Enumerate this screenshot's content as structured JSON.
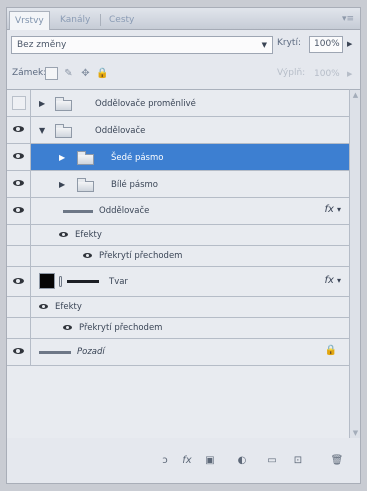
{
  "tabs": [
    {
      "label": "Vrstvy"
    },
    {
      "label": "Kanály"
    },
    {
      "label": "Cesty"
    }
  ],
  "panel_menu_icon": "panel-menu-icon",
  "blend_mode": {
    "value": "Bez změny"
  },
  "opacity": {
    "label": "Krytí:",
    "value": "100%"
  },
  "lock": {
    "label": "Zámek:",
    "icons": [
      "lock-transparent-icon",
      "lock-image-icon",
      "lock-position-icon",
      "lock-all-icon"
    ]
  },
  "fill": {
    "label": "Výplň:",
    "value": "100%"
  },
  "layers": [
    {
      "name": "Oddělovače proměnlivé",
      "type": "group",
      "expanded": false,
      "visible": false
    },
    {
      "name": "Oddělovače",
      "type": "group",
      "expanded": true,
      "visible": true
    },
    {
      "name": "Šedé pásmo",
      "type": "group",
      "expanded": false,
      "visible": true,
      "selected": true
    },
    {
      "name": "Bílé pásmo",
      "type": "group",
      "expanded": false,
      "visible": true
    },
    {
      "name": "Oddělovače",
      "type": "shape",
      "visible": true,
      "fx": "fx"
    },
    {
      "name": "Efekty",
      "type": "effects-header",
      "visible": true
    },
    {
      "name": "Překrytí přechodem",
      "type": "effect",
      "visible": true
    },
    {
      "name": "Tvar",
      "type": "shape",
      "visible": true,
      "fx": "fx"
    },
    {
      "name": "Efekty",
      "type": "effects-header",
      "visible": true
    },
    {
      "name": "Překrytí přechodem",
      "type": "effect",
      "visible": true
    },
    {
      "name": "Pozadí",
      "type": "background",
      "visible": true,
      "locked": true
    }
  ],
  "toolbar": {
    "icons": [
      "link-layers-icon",
      "fx-icon",
      "add-mask-icon",
      "adjustment-layer-icon",
      "new-group-icon",
      "new-layer-icon",
      "delete-layer-icon"
    ],
    "glyphs": [
      "ↄ",
      "fx",
      "▣",
      "◐",
      "▭",
      "⊡",
      "🗑"
    ]
  }
}
